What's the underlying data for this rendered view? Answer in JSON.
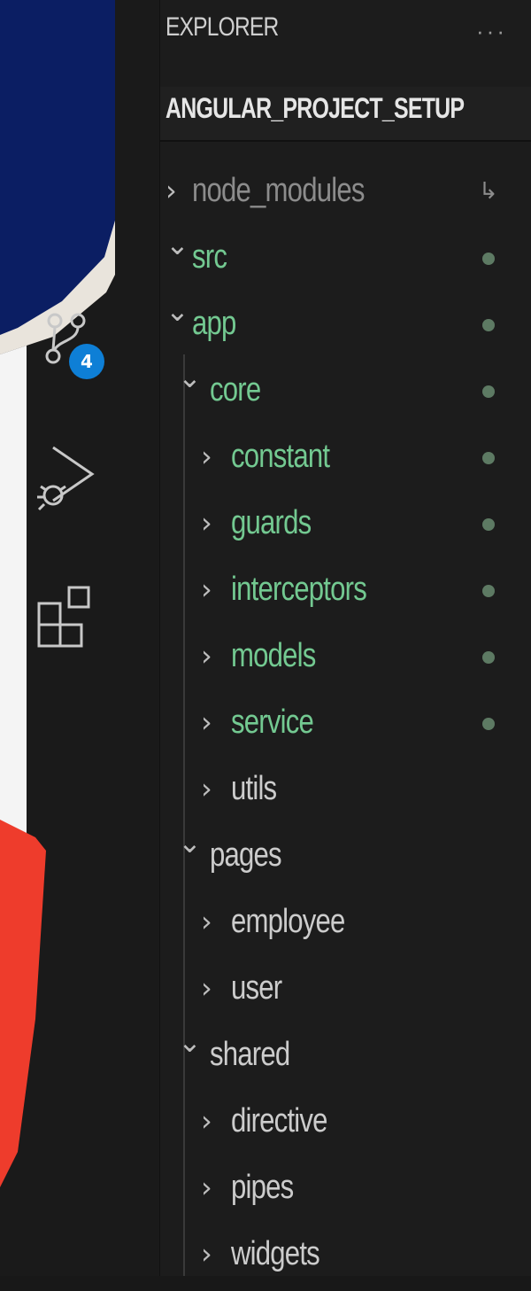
{
  "explorer": {
    "title": "EXPLORER",
    "more_label": "···",
    "project_name": "ANGULAR_PROJECT_SETUP",
    "source_control_badge": "4"
  },
  "tree": [
    {
      "label": "node_modules",
      "expanded": false,
      "depth": 0,
      "status": "ignored",
      "marker": "↳"
    },
    {
      "label": "src",
      "expanded": true,
      "depth": 0,
      "status": "untracked"
    },
    {
      "label": "app",
      "expanded": true,
      "depth": 1,
      "status": "untracked"
    },
    {
      "label": "core",
      "expanded": true,
      "depth": 2,
      "status": "untracked"
    },
    {
      "label": "constant",
      "expanded": false,
      "depth": 3,
      "status": "untracked"
    },
    {
      "label": "guards",
      "expanded": false,
      "depth": 3,
      "status": "untracked"
    },
    {
      "label": "interceptors",
      "expanded": false,
      "depth": 3,
      "status": "untracked"
    },
    {
      "label": "models",
      "expanded": false,
      "depth": 3,
      "status": "untracked"
    },
    {
      "label": "service",
      "expanded": false,
      "depth": 3,
      "status": "untracked"
    },
    {
      "label": "utils",
      "expanded": false,
      "depth": 3,
      "status": "none"
    },
    {
      "label": "pages",
      "expanded": true,
      "depth": 2,
      "status": "none"
    },
    {
      "label": "employee",
      "expanded": false,
      "depth": 3,
      "status": "none"
    },
    {
      "label": "user",
      "expanded": false,
      "depth": 3,
      "status": "none"
    },
    {
      "label": "shared",
      "expanded": true,
      "depth": 2,
      "status": "none"
    },
    {
      "label": "directive",
      "expanded": false,
      "depth": 3,
      "status": "none"
    },
    {
      "label": "pipes",
      "expanded": false,
      "depth": 3,
      "status": "none"
    },
    {
      "label": "widgets",
      "expanded": false,
      "depth": 3,
      "status": "none"
    }
  ],
  "colors": {
    "untracked": "#73c991",
    "normal": "#cccccc",
    "ignored": "#8c8c8c",
    "badge": "#0e7fd6"
  }
}
